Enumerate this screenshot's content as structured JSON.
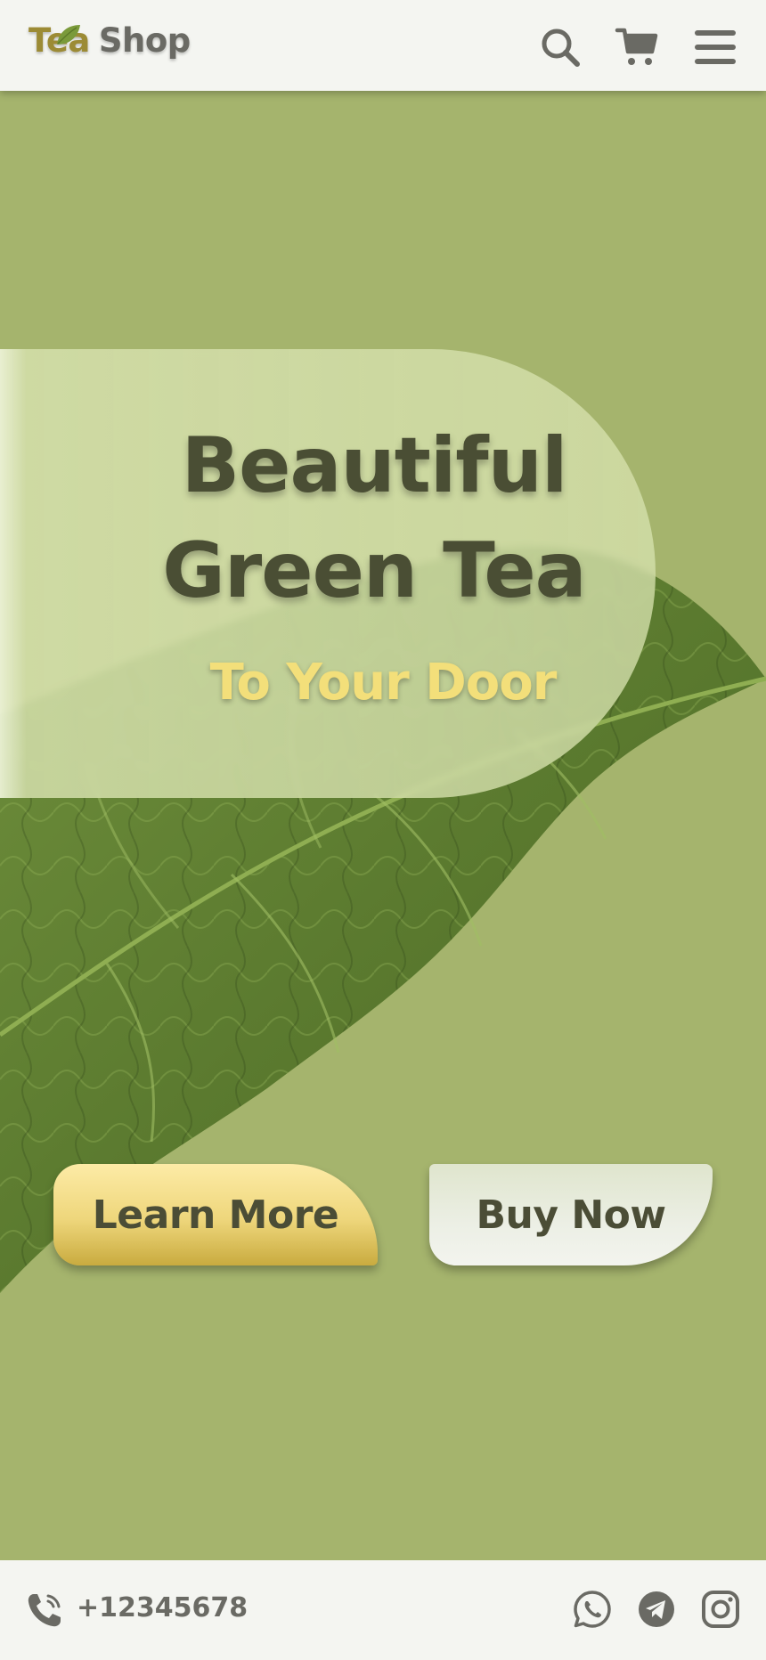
{
  "header": {
    "logo_part1": "Tea",
    "logo_part2": "Shop",
    "icons": [
      "search-icon",
      "cart-icon",
      "menu-icon"
    ]
  },
  "hero": {
    "headline_line1": "Beautiful",
    "headline_line2": "Green Tea",
    "subheadline": "To Your Door",
    "learn_more_label": "Learn More",
    "buy_now_label": "Buy Now"
  },
  "footer": {
    "phone": "+12345678",
    "social_icons": [
      "whatsapp-icon",
      "telegram-icon",
      "instagram-icon"
    ]
  },
  "colors": {
    "background": "#a5b46d",
    "header_bg": "#f4f5f1",
    "text_dark": "#4a4e34",
    "accent_gold": "#f3df7a",
    "logo_tea": "#9c8b35",
    "logo_shop": "#6a6a64"
  }
}
